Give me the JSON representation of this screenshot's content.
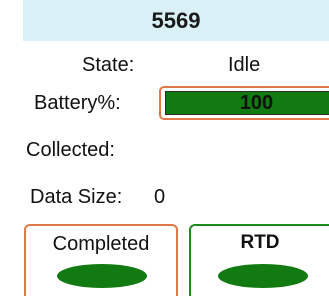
{
  "header": {
    "title": "5569"
  },
  "state": {
    "label": "State:",
    "value": "Idle"
  },
  "battery": {
    "label": "Battery%:",
    "value": "100",
    "level_percent": 100,
    "fill_color": "#117a11"
  },
  "collected": {
    "label": "Collected:"
  },
  "data_size": {
    "label": "Data Size:",
    "value": "0"
  },
  "buttons": {
    "completed": {
      "label": "Completed",
      "indicator_color": "#117a11"
    },
    "rtd": {
      "label": "RTD",
      "indicator_color": "#117a11"
    }
  },
  "colors": {
    "header_bg": "#d8f0f6",
    "highlight_border": "#e07848",
    "active_border": "#1e8a1e"
  }
}
